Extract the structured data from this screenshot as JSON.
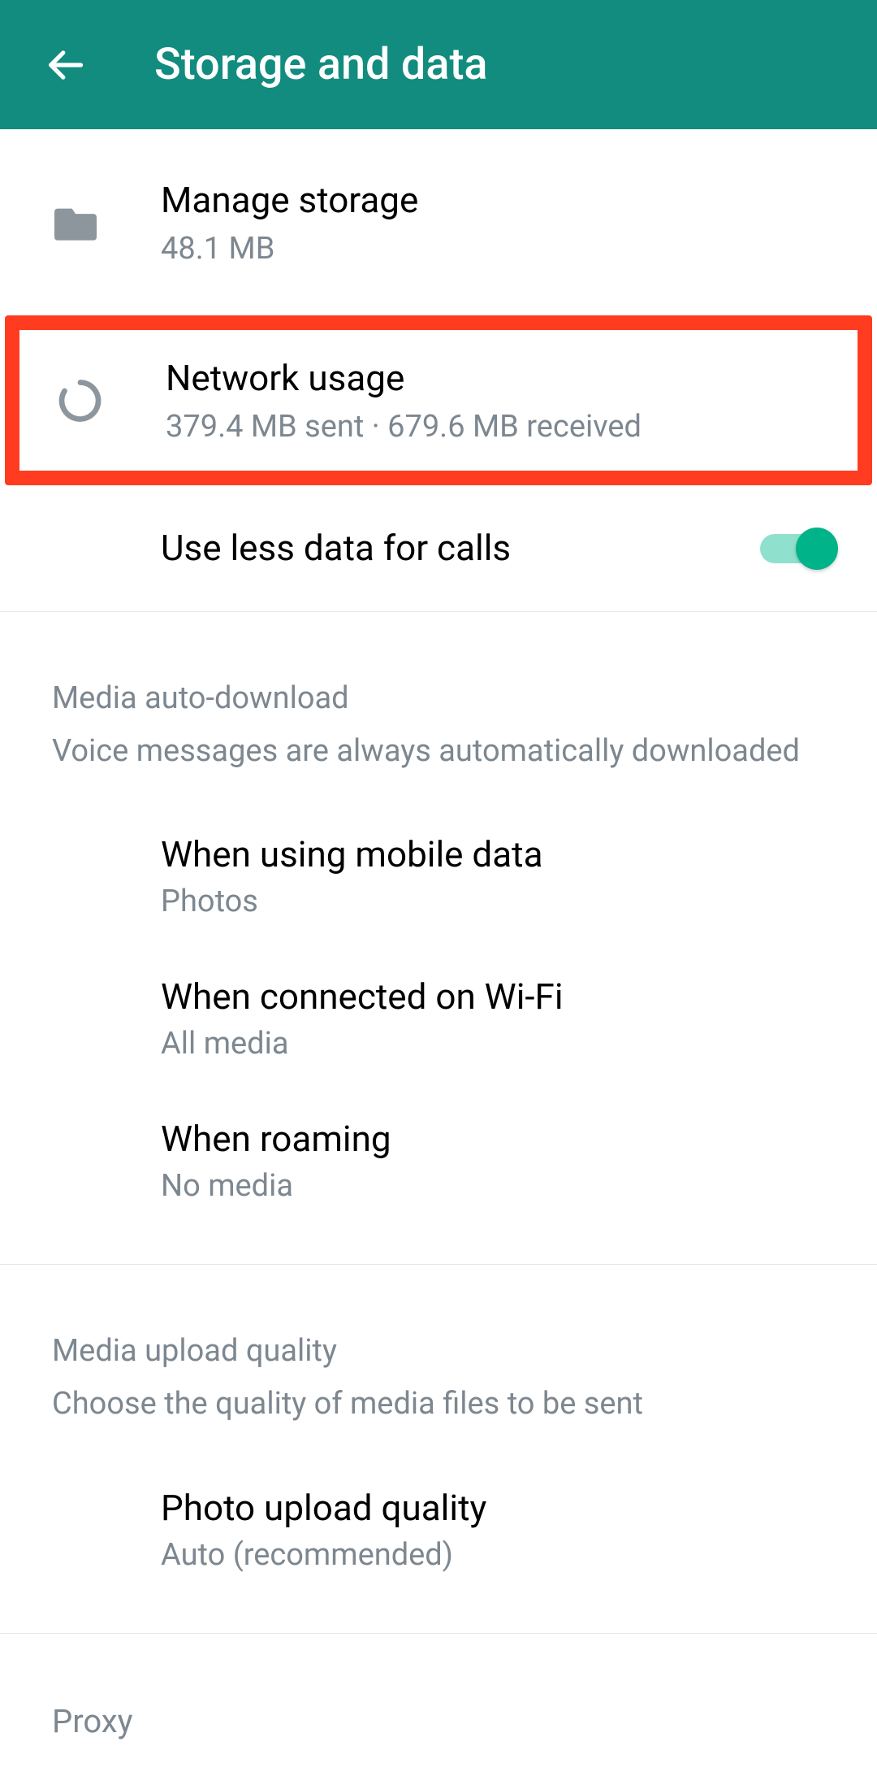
{
  "header": {
    "title": "Storage and data"
  },
  "items": {
    "manage_storage": {
      "title": "Manage storage",
      "sub": "48.1 MB"
    },
    "network_usage": {
      "title": "Network usage",
      "sub": "379.4 MB sent · 679.6 MB received"
    },
    "use_less_data": {
      "title": "Use less data for calls"
    }
  },
  "media_auto": {
    "section_title": "Media auto-download",
    "section_sub": "Voice messages are always automatically downloaded",
    "mobile": {
      "title": "When using mobile data",
      "sub": "Photos"
    },
    "wifi": {
      "title": "When connected on Wi-Fi",
      "sub": "All media"
    },
    "roaming": {
      "title": "When roaming",
      "sub": "No media"
    }
  },
  "upload": {
    "section_title": "Media upload quality",
    "section_sub": "Choose the quality of media files to be sent",
    "photo": {
      "title": "Photo upload quality",
      "sub": "Auto (recommended)"
    }
  },
  "proxy": {
    "section_title": "Proxy"
  },
  "colors": {
    "accent": "#128C7E",
    "highlight": "#ff3c1f",
    "switch_on": "#00b388"
  }
}
